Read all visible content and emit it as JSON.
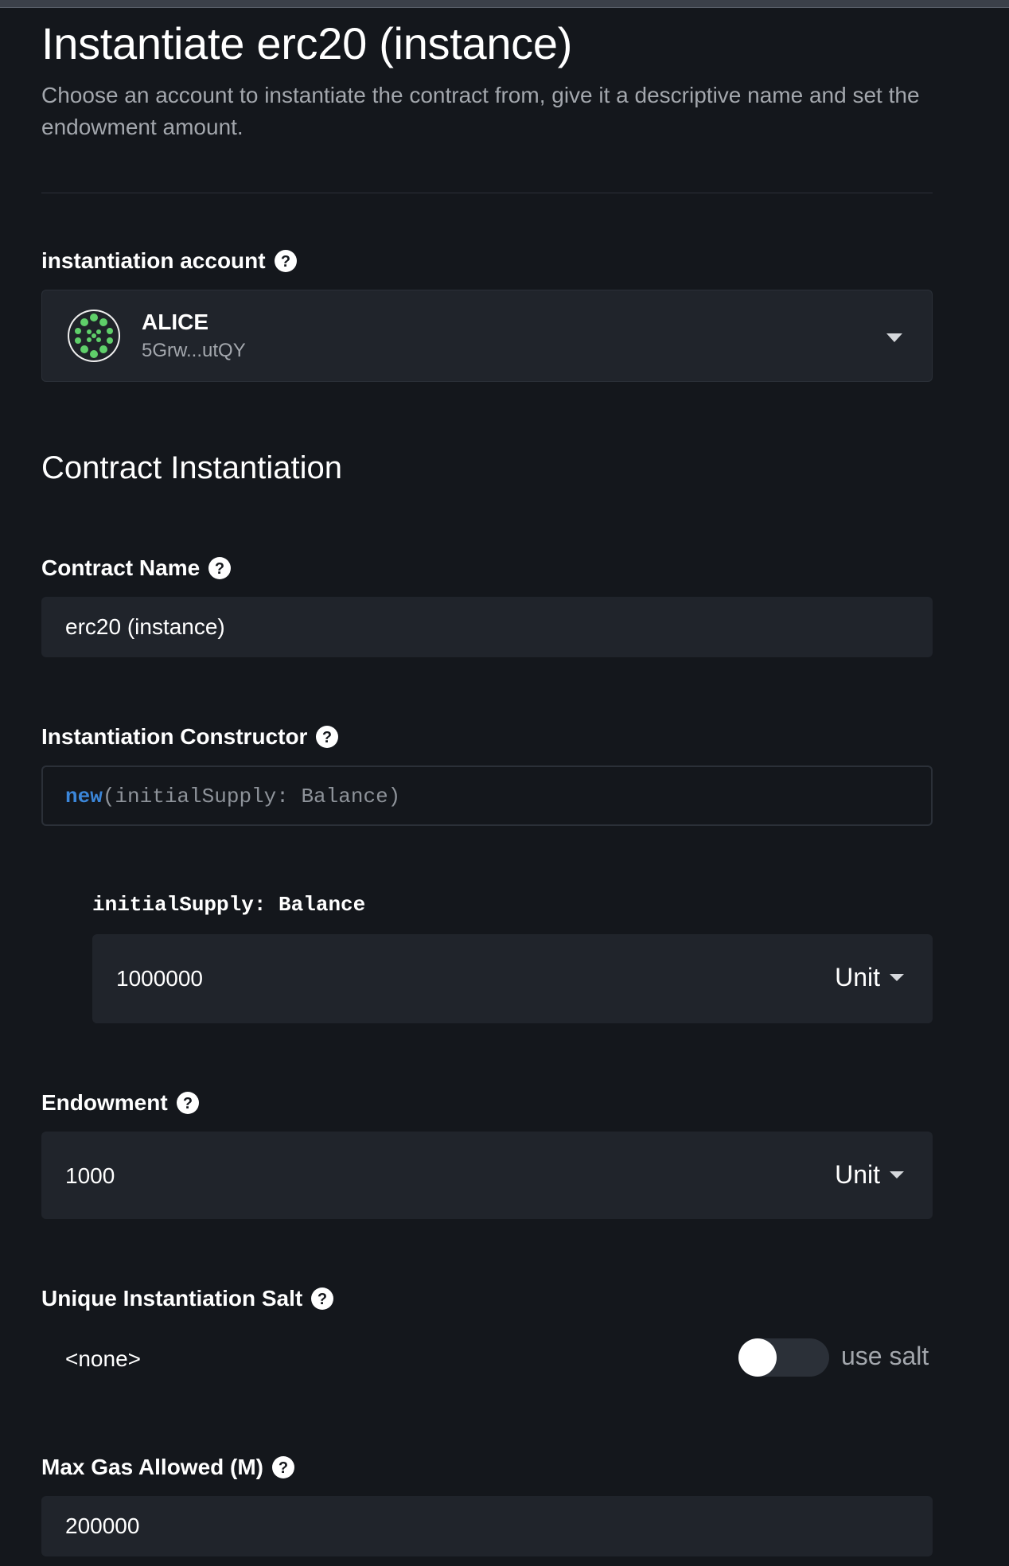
{
  "page": {
    "title": "Instantiate erc20 (instance)",
    "subtitle": "Choose an account to instantiate the contract from, give it a descriptive name and set the endowment amount."
  },
  "account": {
    "label": "instantiation account",
    "name": "ALICE",
    "address": "5Grw...utQY"
  },
  "contract_section": {
    "title": "Contract Instantiation"
  },
  "contract_name": {
    "label": "Contract Name",
    "value": "erc20 (instance)"
  },
  "constructor": {
    "label": "Instantiation Constructor",
    "keyword": "new",
    "signature": "(initialSupply: Balance)",
    "param_label": "initialSupply: Balance",
    "param_value": "1000000",
    "param_unit": "Unit"
  },
  "endowment": {
    "label": "Endowment",
    "value": "1000",
    "unit": "Unit"
  },
  "salt": {
    "label": "Unique Instantiation Salt",
    "value": "<none>",
    "toggle_label": "use salt",
    "toggle_on": false
  },
  "gas": {
    "label": "Max Gas Allowed (M)",
    "value": "200000"
  },
  "colors": {
    "background": "#14171c",
    "field": "#20242b",
    "keyword": "#3b86d9",
    "avatar_dots": "#5fcf6a"
  },
  "icons": {
    "help": "question-circle-icon",
    "dropdown": "caret-down-icon",
    "avatar": "identicon"
  }
}
